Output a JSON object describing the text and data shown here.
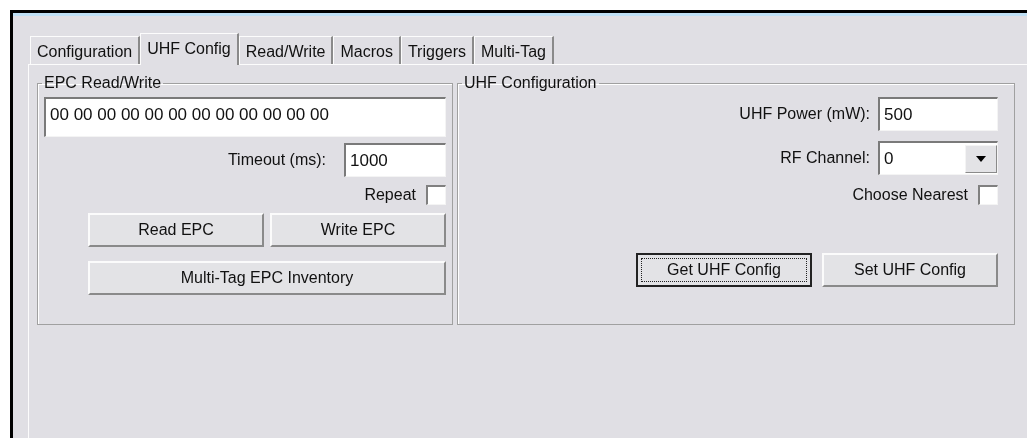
{
  "tabs": [
    {
      "label": "Configuration",
      "selected": false
    },
    {
      "label": "UHF Config",
      "selected": true
    },
    {
      "label": "Read/Write",
      "selected": false
    },
    {
      "label": "Macros",
      "selected": false
    },
    {
      "label": "Triggers",
      "selected": false
    },
    {
      "label": "Multi-Tag",
      "selected": false
    }
  ],
  "epc_group": {
    "title": "EPC Read/Write",
    "epc_value": "00 00 00 00 00 00 00 00 00 00 00 00",
    "timeout_label": "Timeout (ms):",
    "timeout_value": "1000",
    "repeat": {
      "label": "Repeat",
      "checked": false
    },
    "buttons": [
      {
        "label": "Read EPC",
        "focused": false
      },
      {
        "label": "Write EPC",
        "focused": false
      }
    ],
    "inventory_button": {
      "label": "Multi-Tag EPC Inventory",
      "focused": false
    }
  },
  "uhf_group": {
    "title": "UHF Configuration",
    "power_label": "UHF Power (mW):",
    "power_value": "500",
    "channel_label": "RF Channel:",
    "channel_value": "0",
    "choose_nearest": {
      "label": "Choose Nearest",
      "checked": false
    },
    "buttons": [
      {
        "label": "Get UHF Config",
        "focused": true
      },
      {
        "label": "Set UHF Config",
        "focused": false
      }
    ]
  }
}
